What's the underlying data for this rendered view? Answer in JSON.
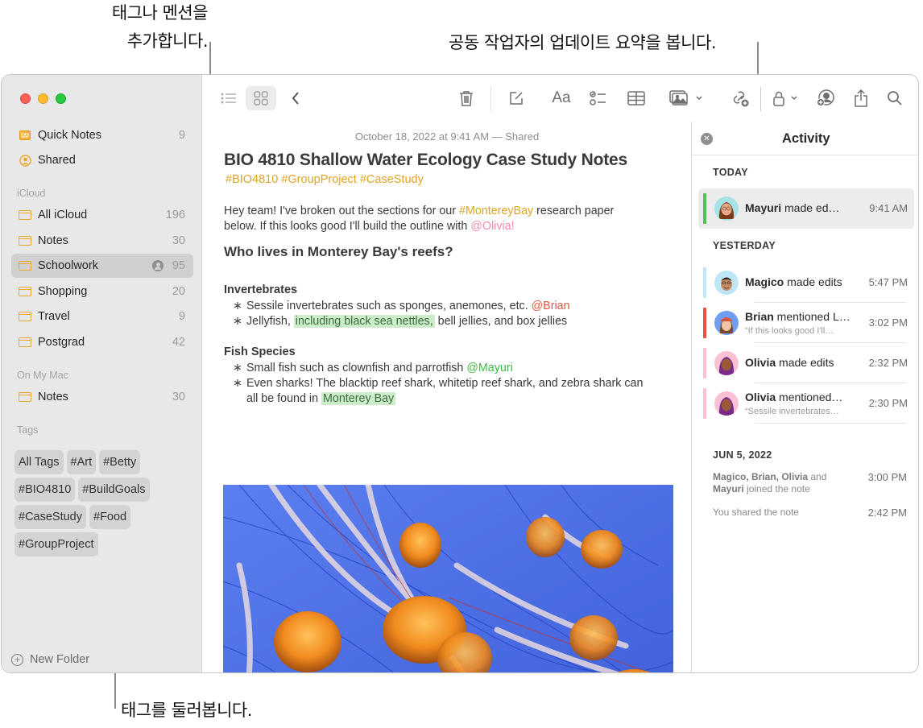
{
  "callouts": {
    "tags_mentions_line1": "태그나 멘션을",
    "tags_mentions_line2": "추가합니다.",
    "activity_summary": "공동 작업자의 업데이트 요약을 봅니다.",
    "browse_tags": "태그를 둘러봅니다."
  },
  "sidebar": {
    "pinned": [
      {
        "label": "Quick Notes",
        "count": "9",
        "icon": "quick-notes-icon"
      },
      {
        "label": "Shared",
        "count": "",
        "icon": "shared-person-icon"
      }
    ],
    "icloud_header": "iCloud",
    "icloud_folders": [
      {
        "label": "All iCloud",
        "count": "196"
      },
      {
        "label": "Notes",
        "count": "30"
      },
      {
        "label": "Schoolwork",
        "count": "95",
        "selected": true,
        "shared": true
      },
      {
        "label": "Shopping",
        "count": "20"
      },
      {
        "label": "Travel",
        "count": "9"
      },
      {
        "label": "Postgrad",
        "count": "42"
      }
    ],
    "mac_header": "On My Mac",
    "mac_folders": [
      {
        "label": "Notes",
        "count": "30"
      }
    ],
    "tags_header": "Tags",
    "tags": [
      "All Tags",
      "#Art",
      "#Betty",
      "#BIO4810",
      "#BuildGoals",
      "#CaseStudy",
      "#Food",
      "#GroupProject"
    ],
    "new_folder": "New Folder"
  },
  "toolbar": {
    "icons": [
      "list-view-icon",
      "gallery-view-icon",
      "back-chevron-icon",
      "trash-icon",
      "compose-icon",
      "format-text-icon",
      "checklist-icon",
      "table-icon",
      "media-icon",
      "collaborate-link-icon",
      "lock-icon",
      "add-people-icon",
      "share-icon",
      "search-icon"
    ],
    "format_label": "Aa"
  },
  "note": {
    "date": "October 18, 2022 at 9:41 AM — Shared",
    "title": "BIO 4810 Shallow Water Ecology Case Study Notes",
    "tags": "#BIO4810 #GroupProject #CaseStudy",
    "intro_line1_a": "Hey team! I've broken out the sections for our ",
    "intro_line1_tag": "#MontereyBay",
    "intro_line1_b": " research paper",
    "intro_line2_a": "below. If this looks good I'll build the outline with ",
    "intro_line2_mention": "@Olivia!",
    "heading": "Who lives in Monterey Bay's reefs?",
    "bullet_char": "∗",
    "sections": {
      "invertebrates": {
        "title": "Invertebrates",
        "b1_text": "Sessile invertebrates such as sponges, anemones, etc. ",
        "b1_mention": "@Brian",
        "b2_a": "Jellyfish, ",
        "b2_highlight": "including black sea nettles,",
        "b2_b": " bell jellies, and box jellies"
      },
      "fish": {
        "title": "Fish Species",
        "b1_text": "Small fish such as clownfish and parrotfish ",
        "b1_mention": "@Mayuri",
        "b2_line1": "Even sharks! The blacktip reef shark, whitetip reef shark, and zebra shark can",
        "b2_line2_a": "all be found in ",
        "b2_line2_highlight": "Monterey Bay"
      }
    },
    "image_alt": "Photo of orange sea nettle jellyfish on blue background"
  },
  "activity": {
    "title": "Activity",
    "today_header": "TODAY",
    "yesterday_header": "YESTERDAY",
    "today": [
      {
        "name": "Mayuri",
        "action": " made ed…",
        "time": "9:41 AM",
        "color": "#4cc551",
        "selected": true
      }
    ],
    "yesterday": [
      {
        "name": "Magico",
        "action": " made edits",
        "time": "5:47 PM",
        "color": "#bfe6f7",
        "sub": ""
      },
      {
        "name": "Brian",
        "action": " mentioned L…",
        "time": "3:02 PM",
        "color": "#e8533f",
        "sub": "“If this looks good I'll…"
      },
      {
        "name": "Olivia",
        "action": " made edits",
        "time": "2:32 PM",
        "color": "#f9c1d3",
        "sub": ""
      },
      {
        "name": "Olivia",
        "action": " mentioned…",
        "time": "2:30 PM",
        "color": "#f9c1d3",
        "sub": "“Sessile invertebrates…"
      }
    ],
    "date_header": "JUN 5, 2022",
    "log": [
      {
        "names": "Magico, Brian, Olivia",
        "and": " and",
        "name2": "Mayuri",
        "rest": " joined the note",
        "time": "3:00 PM"
      },
      {
        "text": "You shared the note",
        "time": "2:42 PM"
      }
    ]
  }
}
